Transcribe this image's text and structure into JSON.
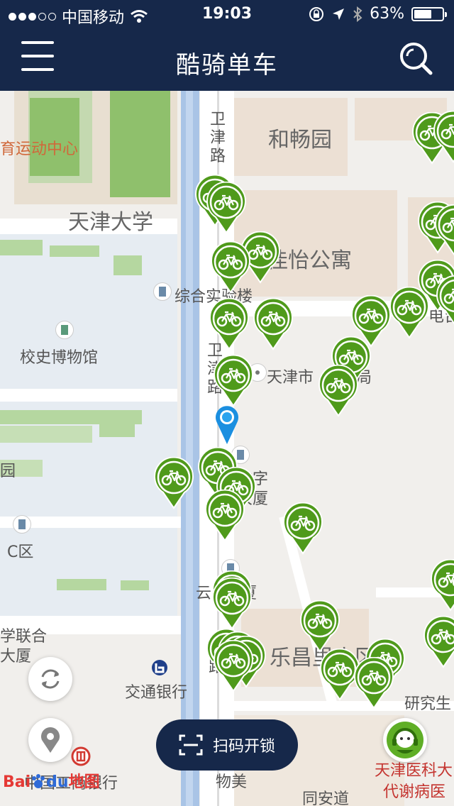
{
  "status_bar": {
    "carrier": "中国移动",
    "time": "19:03",
    "battery": "63%",
    "battery_level": 0.63
  },
  "nav": {
    "title": "酷骑单车",
    "menu_icon": "menu-icon",
    "search_icon": "search-icon"
  },
  "map": {
    "labels": {
      "sports_center": "育运动中心",
      "tianjin_university": "天津大学",
      "hechang_yuan": "和畅园",
      "jiayi_apartment": "佳怡公寓",
      "lab_building": "综合实验楼",
      "history_museum": "校史博物馆",
      "tianjin_bureau": "天津市",
      "bureau_suffix": "局",
      "weijin_road_top": "卫津路",
      "weijin_road_mid": "卫津路",
      "digital_building": "数字大厦",
      "zone_c": "C区",
      "yun_building": "云厦",
      "lechangli": "乐昌里小区",
      "union_building": "学联合大厦",
      "bank_of_comm": "交通银行",
      "research": "研究生",
      "icbc": "中国工商银行",
      "medical_univ": "天津医科大",
      "metabolic": "代谢病医",
      "tongan_road": "同安道",
      "wumei": "物美",
      "diantai": "电台",
      "park_suffix": "园"
    },
    "bike_count": 34
  },
  "scan_button": {
    "label": "扫码开锁"
  },
  "controls": {
    "refresh_icon": "refresh-icon",
    "location_icon": "location-icon",
    "service_icon": "customer-service-icon"
  },
  "attribution": {
    "baidu": "Bai",
    "du": "du",
    "map": "地图"
  },
  "colors": {
    "nav_bg": "#16284a",
    "bike_green": "#4f9a1b",
    "user_blue": "#1b8fe0"
  }
}
